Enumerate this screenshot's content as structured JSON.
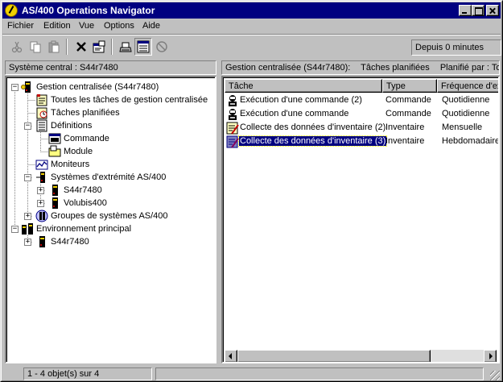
{
  "window": {
    "title": "AS/400 Operations Navigator"
  },
  "menu": [
    "Fichier",
    "Edition",
    "Vue",
    "Options",
    "Aide"
  ],
  "toolbar": {
    "buttons": [
      "cut-icon",
      "copy-icon",
      "paste-icon",
      "delete-icon",
      "properties-icon",
      "print-icon",
      "view-icon",
      "stop-icon"
    ],
    "refresh_status": "Depuis 0 minutes"
  },
  "left_pane": {
    "header": "Système central : S44r7480",
    "tree": [
      {
        "label": "Gestion centralisée (S44r7480)",
        "icon": "central-management-icon"
      },
      {
        "label": "Toutes les tâches de gestion centralisée",
        "icon": "all-tasks-icon"
      },
      {
        "label": "Tâches planifiées",
        "icon": "scheduled-tasks-icon"
      },
      {
        "label": "Définitions",
        "icon": "definitions-icon"
      },
      {
        "label": "Commande",
        "icon": "command-icon"
      },
      {
        "label": "Module",
        "icon": "folder-icon"
      },
      {
        "label": "Moniteurs",
        "icon": "monitor-icon"
      },
      {
        "label": "Systèmes d'extrémité AS/400",
        "icon": "endpoint-systems-icon"
      },
      {
        "label": "S44r7480",
        "icon": "server-icon"
      },
      {
        "label": "Volubis400",
        "icon": "server-icon"
      },
      {
        "label": "Groupes de systèmes AS/400",
        "icon": "system-groups-icon"
      },
      {
        "label": "Environnement principal",
        "icon": "environment-icon"
      },
      {
        "label": "S44r7480",
        "icon": "server-icon"
      }
    ]
  },
  "right_pane": {
    "header_parts": [
      "Gestion centralisée (S44r7480):",
      "Tâches planifiées",
      "Planifié par : Tout..."
    ],
    "columns": [
      "Tâche",
      "Type",
      "Fréquence d'ex"
    ],
    "rows": [
      {
        "name": "Exécution d'une commande (2)",
        "type": "Commande",
        "frequency": "Quotidienne",
        "icon": "run-command-icon"
      },
      {
        "name": "Exécution d'une commande",
        "type": "Commande",
        "frequency": "Quotidienne",
        "icon": "run-command-icon"
      },
      {
        "name": "Collecte des données d'inventaire (2)",
        "type": "Inventaire",
        "frequency": "Mensuelle",
        "icon": "inventory-icon"
      },
      {
        "name": "Collecte des données d'inventaire (3)",
        "type": "Inventaire",
        "frequency": "Hebdomadaire",
        "icon": "inventory-icon"
      }
    ],
    "selected_index": 3
  },
  "status": {
    "text": "1 - 4 objet(s) sur 4"
  }
}
